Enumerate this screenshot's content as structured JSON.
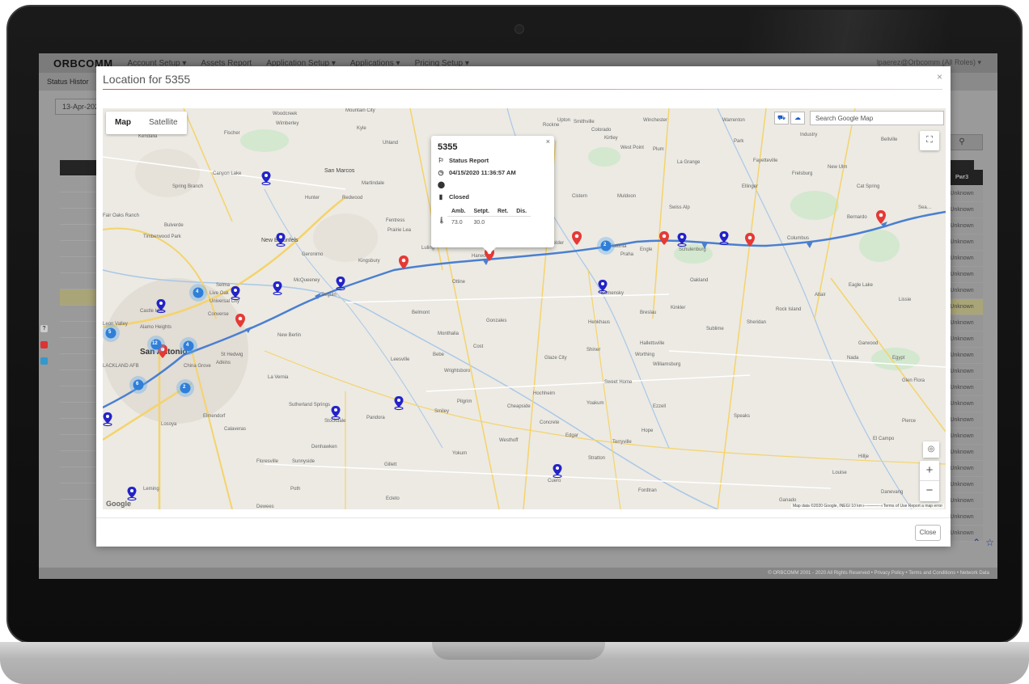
{
  "app": {
    "logo": "ORBCOMM",
    "nav": [
      "Account Setup ▾",
      "Assets Report",
      "Application Setup ▾",
      "Applications ▾",
      "Pricing Setup ▾"
    ],
    "user": "lpaerez@Orbcomm (All Roles) ▾",
    "subtitle": "Status Histor",
    "date_value": "13-Apr-202",
    "right_column_header": "Pwr3",
    "right_column_value": "Unknown",
    "footer": "© ORBCOMM 2001 - 2020 All Rights Reserved  •  Privacy Policy  •  Terms and Conditions  •  Network Data"
  },
  "modal": {
    "title": "Location for 5355",
    "close_label": "Close",
    "close_x": "×"
  },
  "map": {
    "map_type": {
      "map": "Map",
      "satellite": "Satellite"
    },
    "search_placeholder": "Search Google Map",
    "attribution": "Map data ©2020 Google, INEGI   10 km ⟝———⟞   Terms of Use   Report a map error",
    "google_logo": "Google",
    "zoom_in": "+",
    "zoom_out": "−",
    "towns": {
      "woodcreek": "Woodcreek",
      "wimberley": "Wimberley",
      "fischer": "Fischer",
      "kyle": "Kyle",
      "mountain_city": "Mountain City",
      "uhland": "Uhland",
      "kendalia": "Kendalia",
      "rockne": "Rockne",
      "upton": "Upton",
      "smithville": "Smithville",
      "colorado": "Colorado",
      "kirtley": "Kirtley",
      "winchester": "Winchester",
      "warrenton": "Warrenton",
      "industry": "Industry",
      "bellville": "Bellville",
      "west_point": "West Point",
      "plum": "Plum",
      "la_grange": "La Grange",
      "fayetteville": "Fayetteville",
      "new_ulm": "New Ulm",
      "frelsburg": "Frelsburg",
      "cat_spring": "Cat Spring",
      "park": "Park",
      "canyon_lake": "Canyon Lake",
      "san_marcos": "San Marcos",
      "martindale": "Martindale",
      "spring_branch": "Spring Branch",
      "hunter": "Hunter",
      "redwood": "Redwood",
      "cistern": "Cistern",
      "muldoon": "Muldoon",
      "ellinger": "Ellinger",
      "fair_oaks_ranch": "Fair Oaks Ranch",
      "bulverde": "Bulverde",
      "fentress": "Fentress",
      "prairie_lea": "Prairie Lea",
      "swiss_alp": "Swiss Alp",
      "bernardo": "Bernardo",
      "sealy": "Sea…",
      "timberwood_park": "Timberwood Park",
      "new_braunfels": "New Braunfels",
      "geronimo": "Geronimo",
      "kingsbury": "Kingsbury",
      "luling": "Luling",
      "harwood": "Harwood",
      "waelder": "Waelder",
      "flatonia": "Flatonia",
      "praha": "Praha",
      "engle": "Engle",
      "schulenburg": "Schulenburg",
      "columbus": "Columbus",
      "mcqueeney": "McQueeney",
      "selma": "Selma",
      "live_oak": "Live Oak",
      "universal_city": "Universal City",
      "seguin": "Seguin",
      "ottine": "Ottine",
      "komensky": "Komensky",
      "oakland": "Oakland",
      "eagle_lake": "Eagle Lake",
      "altair": "Altair",
      "lissie": "Lissie",
      "castle_hills": "Castle Hills",
      "converse": "Converse",
      "leon_valley": "Leon Valley",
      "belmont": "Belmont",
      "gonzales": "Gonzales",
      "kinkler": "Kinkler",
      "breslau": "Breslau",
      "rock_island": "Rock Island",
      "henkhaus": "Henkhaus",
      "sublime": "Sublime",
      "sheridan": "Sheridan",
      "alamo_heights": "Alamo Heights",
      "new_berlin": "New Berlin",
      "monthalia": "Monthalia",
      "san_antonio": "San Antonio",
      "st_hedwig": "St Hedwig",
      "china_grove": "China Grove",
      "adkins": "Adkins",
      "cost": "Cost",
      "leesville": "Leesville",
      "bebe": "Bebe",
      "glaze_city": "Glaze City",
      "shiner": "Shiner",
      "hallettsville": "Hallettsville",
      "worthing": "Worthing",
      "williamsburg": "Williamsburg",
      "garwood": "Garwood",
      "nada": "Nada",
      "egypt": "Egypt",
      "lackland_afb": "LACKLAND AFB",
      "la_vernia": "La Vernia",
      "wrightsboro": "Wrightsboro",
      "sweet_home": "Sweet Home",
      "glen_flora": "Glen Flora",
      "hochheim": "Hochheim",
      "yoakum": "Yoakum",
      "ezzell": "Ezzell",
      "sutherland_springs": "Sutherland Springs",
      "elmendorf": "Elmendorf",
      "stockdale": "Stockdale",
      "pandora": "Pandora",
      "pilgrim": "Pilgrim",
      "cheapside": "Cheapside",
      "smiley": "Smiley",
      "speaks": "Speaks",
      "concrete": "Concrete",
      "lossoya": "Losoya",
      "calaveras": "Calaveras",
      "edgar": "Edgar",
      "hope": "Hope",
      "pierce": "Pierce",
      "westhoff": "Westhoff",
      "el_campo": "El Campo",
      "denhawken": "Denhawken",
      "terryville": "Terryville",
      "yokum": "Yokum",
      "stratton": "Stratton",
      "hillje": "Hillje",
      "floresville": "Floresville",
      "sunnyside": "Sunnyside",
      "gillett": "Gillett",
      "louise": "Louise",
      "leming": "Leming",
      "poth": "Poth",
      "cuero": "Cuero",
      "fordtran": "Fordtran",
      "ganado": "Ganado",
      "danevang": "Danevang",
      "dewees": "Dewees",
      "ecleto": "Ecleto"
    },
    "clusters": [
      "5",
      "12",
      "4",
      "6",
      "2",
      "4",
      "2"
    ]
  },
  "info_window": {
    "asset": "5355",
    "close": "×",
    "event": "Status Report",
    "timestamp": "04/15/2020 11:36:57 AM",
    "door": "Closed",
    "table": {
      "headers": [
        "Amb.",
        "Setpt.",
        "Ret.",
        "Dis."
      ],
      "values": [
        "73.0",
        "30.0",
        "",
        ""
      ]
    }
  },
  "colors": {
    "route": "#4a7fd0",
    "marker_red": "#e53935",
    "marker_blue": "#2323c8",
    "modal_rule": "#d9534f"
  }
}
